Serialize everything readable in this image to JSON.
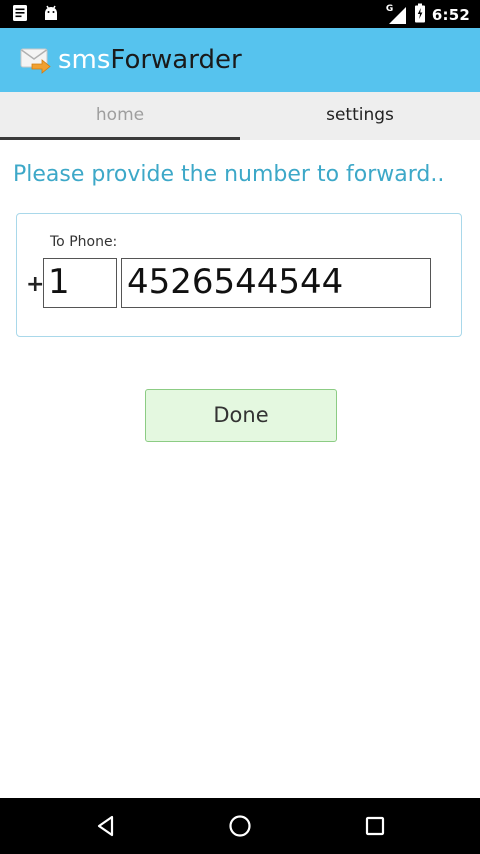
{
  "status_bar": {
    "time": "6:52",
    "network_label": "G",
    "icons": [
      "notification-icon",
      "android-icon",
      "signal-icon",
      "battery-icon"
    ]
  },
  "app_bar": {
    "title_part1": "sms",
    "title_part2": "Forwarder",
    "icon": "envelope-icon",
    "colors": {
      "background": "#56c3ee",
      "title_part1": "#ffffff",
      "title_part2": "#1a1a1a"
    }
  },
  "tabs": [
    {
      "label": "home",
      "selected": true
    },
    {
      "label": "settings",
      "selected": false
    }
  ],
  "form": {
    "prompt": "Please provide the number to forward..",
    "to_phone_label": "To Phone:",
    "plus_sign": "+",
    "country_code": "1",
    "phone_number": "4526544544"
  },
  "done_button": {
    "label": "Done",
    "colors": {
      "background": "#e4f8e0",
      "border": "#8ccc84"
    }
  },
  "nav_bar": {
    "buttons": [
      "back-icon",
      "home-icon",
      "recents-icon"
    ]
  }
}
